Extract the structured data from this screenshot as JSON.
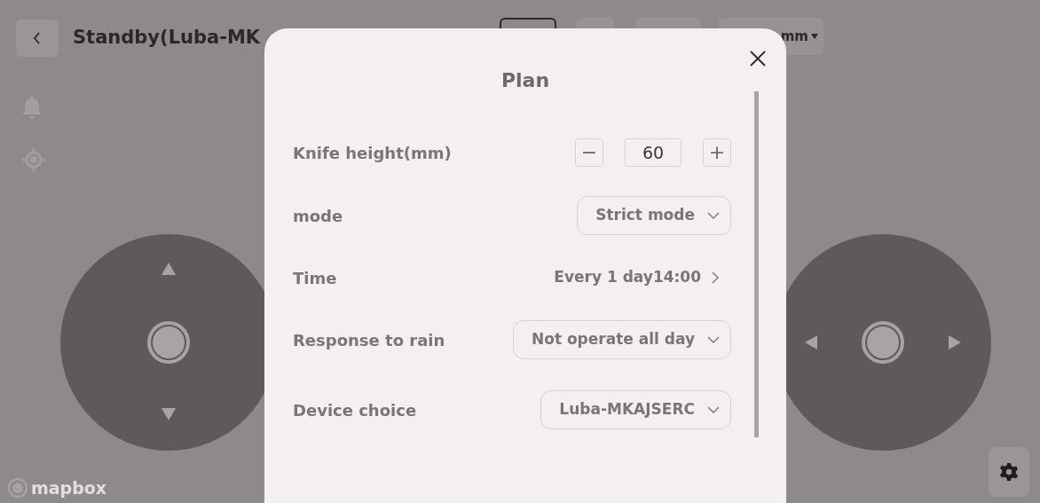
{
  "header": {
    "title": "Standby(Luba-MK",
    "unit_selector": "mm"
  },
  "map": {
    "attribution": "mapbox"
  },
  "modal": {
    "title": "Plan",
    "settings": [
      {
        "kind": "stepper",
        "label": "Knife height(mm)",
        "value": "60",
        "minus": "−",
        "plus": "+"
      },
      {
        "kind": "select",
        "label": "mode",
        "value": "Strict mode"
      },
      {
        "kind": "link",
        "label": "Time",
        "value": "Every 1 day14:00"
      },
      {
        "kind": "select",
        "label": "Response to rain",
        "value": "Not operate all day"
      },
      {
        "kind": "select",
        "label": "Device choice",
        "value": "Luba-MKAJSERC"
      }
    ]
  }
}
